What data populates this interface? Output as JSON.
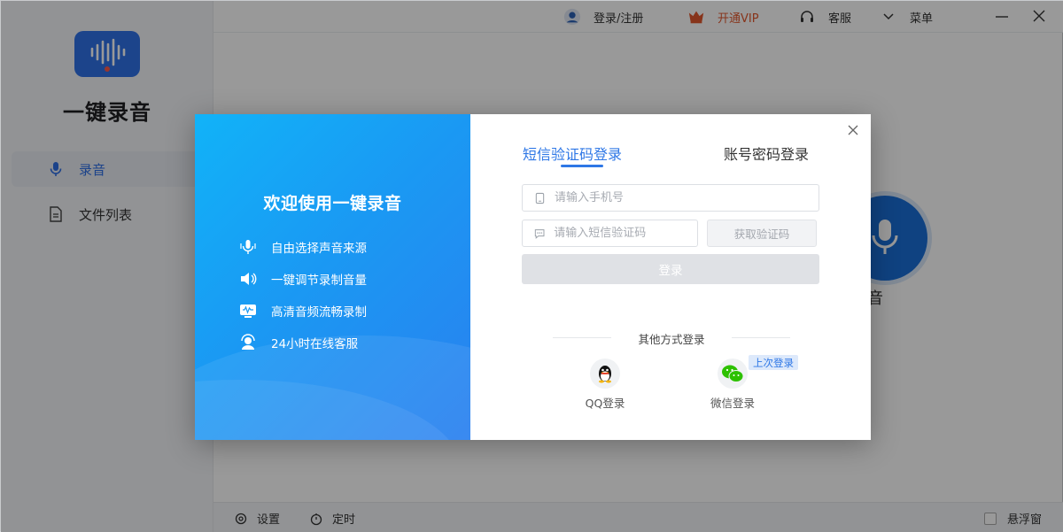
{
  "app": {
    "name": "一键录音",
    "accent": "#2e77e6"
  },
  "sidebar": {
    "items": [
      {
        "label": "录音",
        "icon": "microphone-icon",
        "active": true
      },
      {
        "label": "文件列表",
        "icon": "file-list-icon",
        "active": false
      }
    ]
  },
  "topbar": {
    "login": "登录/注册",
    "vip": "开通VIP",
    "service": "客服",
    "menu": "菜单"
  },
  "main": {
    "record_label": "录音"
  },
  "bottombar": {
    "settings": "设置",
    "timer": "定时",
    "floating": "悬浮窗"
  },
  "dialog": {
    "welcome": "欢迎使用一键录音",
    "features": [
      "自由选择声音来源",
      "一键调节录制音量",
      "高清音频流畅录制",
      "24小时在线客服"
    ],
    "tabs": {
      "sms": "短信验证码登录",
      "password": "账号密码登录"
    },
    "phone_placeholder": "请输入手机号",
    "code_placeholder": "请输入短信验证码",
    "get_code": "获取验证码",
    "login": "登录",
    "other_title": "其他方式登录",
    "qq": "QQ登录",
    "wechat": "微信登录",
    "last_login": "上次登录"
  }
}
